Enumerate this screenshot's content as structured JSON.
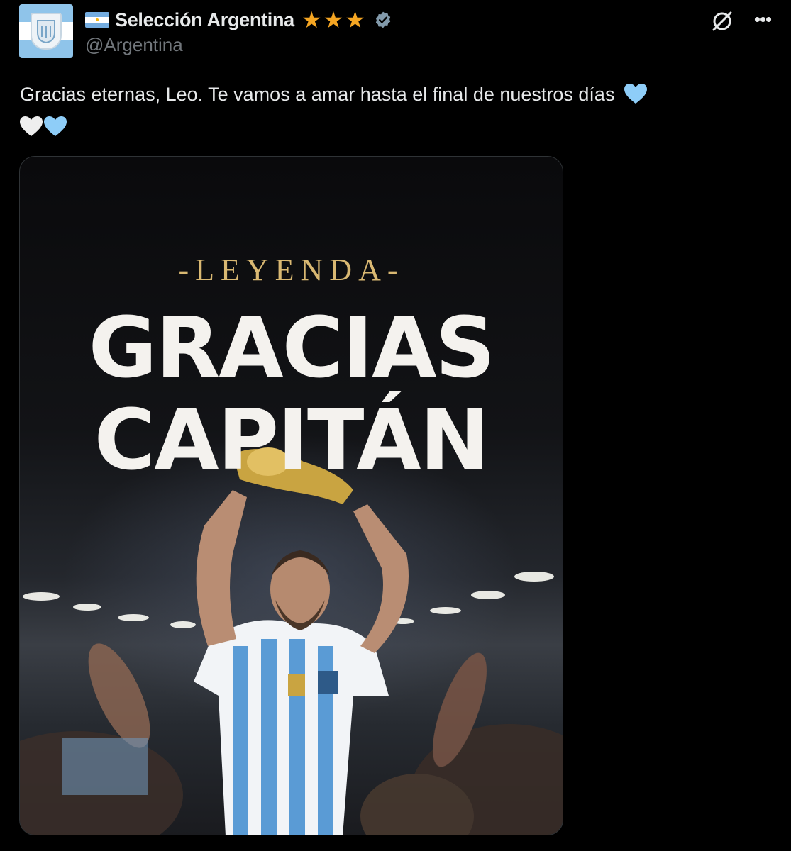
{
  "account": {
    "display_name": "Selección Argentina",
    "handle": "@Argentina",
    "star_count": 3,
    "verified": true,
    "avatar_icon": "afa-crest-icon"
  },
  "actions": {
    "grok_icon": "grok-icon",
    "more_icon": "more-options-icon"
  },
  "tweet": {
    "text": "Gracias eternas, Leo. Te vamos a amar hasta el final de nuestros días"
  },
  "media": {
    "kicker": "-LEYENDA-",
    "headline_line1": "GRACIAS",
    "headline_line2": "CAPITÁN"
  },
  "colors": {
    "background": "#000000",
    "text": "#e7e9ea",
    "muted": "#71767b",
    "star": "#f5a623",
    "verified": "#829aab",
    "heart_blue": "#8ecdf8",
    "heart_white": "#eeeeee",
    "gold": "#d9b872"
  }
}
